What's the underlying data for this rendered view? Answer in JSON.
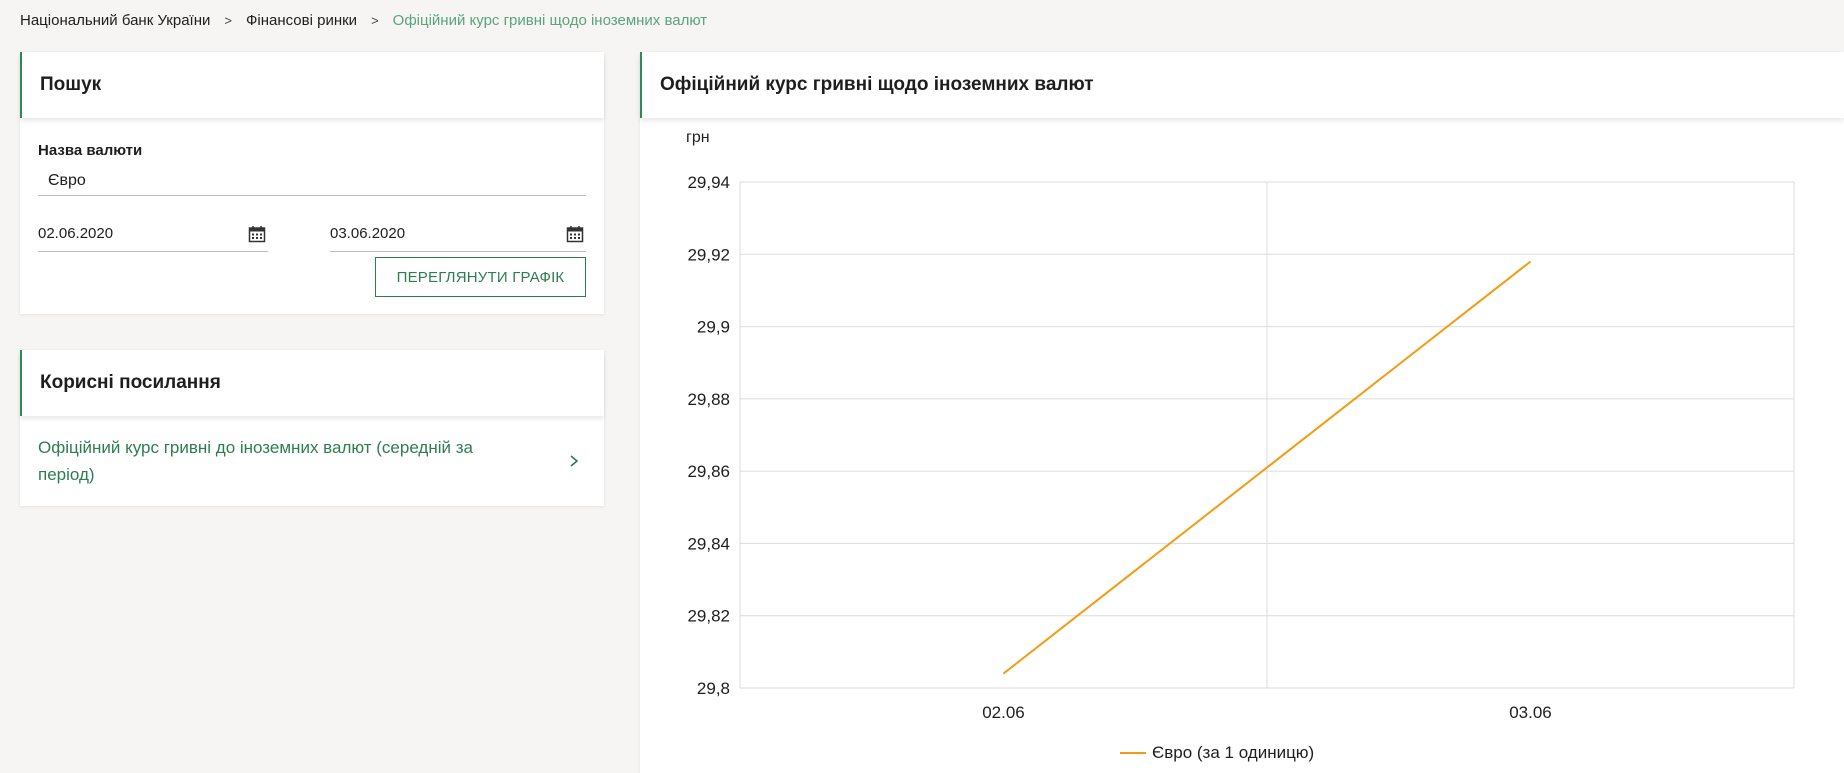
{
  "breadcrumb": {
    "items": [
      "Національний банк України",
      "Фінансові ринки",
      "Офіційний курс гривні щодо іноземних валют"
    ],
    "separator": ">"
  },
  "search": {
    "title": "Пошук",
    "currency_label": "Назва валюти",
    "currency_value": "Євро",
    "date_from": "02.06.2020",
    "date_to": "03.06.2020",
    "button_label": "ПЕРЕГЛЯНУТИ ГРАФІК"
  },
  "links": {
    "title": "Корисні посилання",
    "items": [
      {
        "label": "Офіційний курс гривні до іноземних валют (середній за період)"
      }
    ]
  },
  "chart": {
    "title": "Офіційний курс гривні щодо іноземних валют"
  },
  "colors": {
    "accent": "#2e7d4f",
    "breadcrumb_current": "#5aa37c",
    "series": "#f39c12"
  },
  "chart_data": {
    "type": "line",
    "title": "",
    "ylabel": "грн",
    "xlabel": "",
    "categories": [
      "02.06",
      "03.06"
    ],
    "ylim": [
      29.8,
      29.94
    ],
    "yticks": [
      "29,8",
      "29,82",
      "29,84",
      "29,86",
      "29,88",
      "29,9",
      "29,92",
      "29,94"
    ],
    "grid": true,
    "legend": "bottom",
    "series": [
      {
        "name": "Євро (за 1 одиницю)",
        "values": [
          29.804,
          29.918
        ],
        "color": "#f39c12"
      }
    ]
  }
}
